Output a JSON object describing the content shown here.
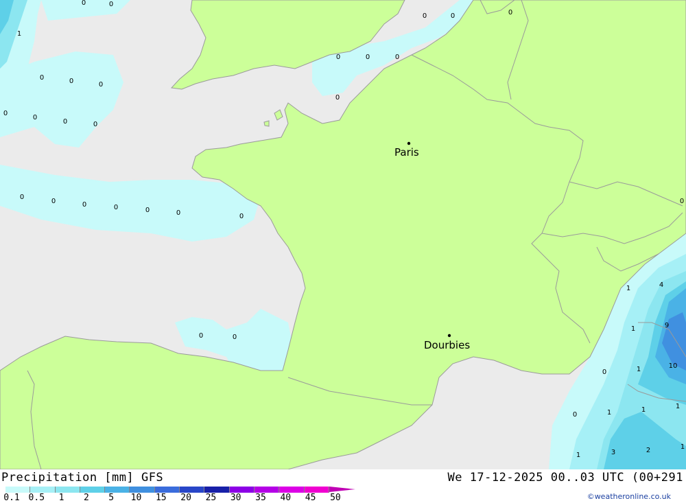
{
  "title": "Precipitation [mm] GFS",
  "timestamp": "We 17-12-2025 00..03 UTC (00+291",
  "credit": "©weatheronline.co.uk",
  "colors": {
    "sea": "#ebebeb",
    "land": "#ccff99",
    "border": "#9a9a9a"
  },
  "cities": [
    {
      "name": "Paris"
    },
    {
      "name": "Dourbies"
    }
  ],
  "map_values": [
    "0",
    "0",
    "1",
    "0",
    "0",
    "0",
    "0",
    "0",
    "0",
    "0",
    "0",
    "0",
    "0",
    "0",
    "0",
    "0",
    "0",
    "0",
    "0",
    "0",
    "0",
    "0",
    "0",
    "0",
    "0",
    "0",
    "0",
    "0",
    "0",
    "1",
    "4",
    "1",
    "9",
    "10",
    "0",
    "1",
    "0",
    "1",
    "1",
    "1",
    "3",
    "2",
    "1",
    "1"
  ],
  "legend": {
    "labels": [
      "0.1",
      "0.5",
      "1",
      "2",
      "5",
      "10",
      "15",
      "20",
      "25",
      "30",
      "35",
      "40",
      "45",
      "50"
    ],
    "colors": [
      "#c8fafa",
      "#a6f0f6",
      "#8ce6f0",
      "#5ed0e8",
      "#4ab2e6",
      "#4090e0",
      "#3a6cdc",
      "#2846c8",
      "#1820a8",
      "#8c00e6",
      "#b400e6",
      "#dc00e6",
      "#f000d0",
      "#c000b4"
    ]
  }
}
